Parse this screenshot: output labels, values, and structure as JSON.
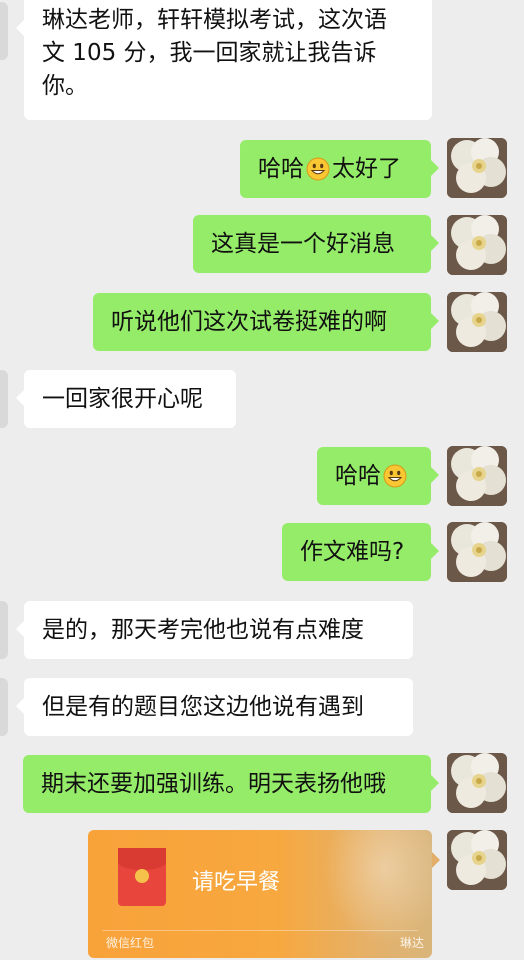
{
  "messages": [
    {
      "side": "in",
      "text_lines": [
        "琳达老师，轩轩模拟考试，这次语",
        "文 105 分，我一回家就让我告诉",
        "你。"
      ]
    },
    {
      "side": "out",
      "parts": [
        "哈哈",
        "太好了"
      ],
      "emoji": "smile-emoji"
    },
    {
      "side": "out",
      "text": "这真是一个好消息"
    },
    {
      "side": "out",
      "text": "听说他们这次试卷挺难的啊"
    },
    {
      "side": "in",
      "text": "一回家很开心呢"
    },
    {
      "side": "out",
      "parts": [
        "哈哈",
        ""
      ],
      "emoji": "smile-emoji"
    },
    {
      "side": "out",
      "text": "作文难吗?"
    },
    {
      "side": "in",
      "text": "是的，那天考完他也说有点难度"
    },
    {
      "side": "in",
      "text": "但是有的题目您这边他说有遇到"
    },
    {
      "side": "out",
      "text": "期末还要加强训练。明天表扬他哦"
    }
  ],
  "red_packet": {
    "title": "请吃早餐",
    "footer": "微信红包",
    "name": "琳达",
    "color": "#f8a23a"
  },
  "colors": {
    "background": "#ededed",
    "incoming": "#ffffff",
    "outgoing": "#95ec69"
  }
}
